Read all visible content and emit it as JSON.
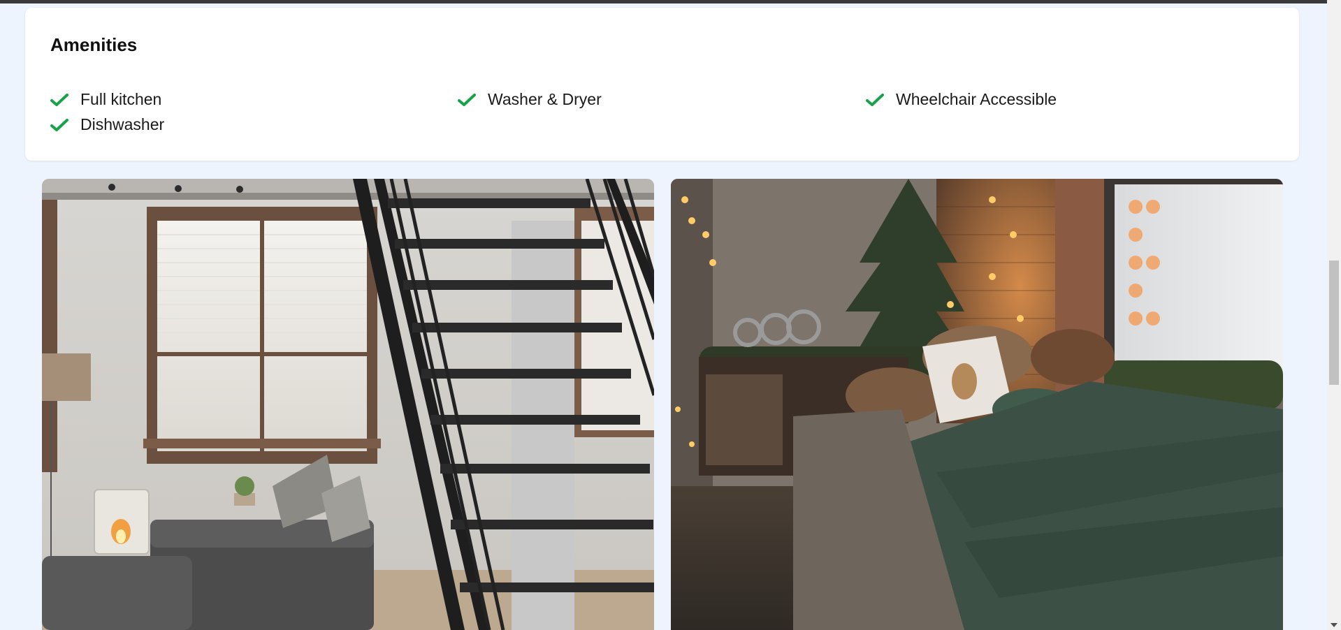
{
  "amenities": {
    "title": "Amenities",
    "items": [
      {
        "label": "Full kitchen",
        "icon": "check-icon"
      },
      {
        "label": "Washer & Dryer",
        "icon": "check-icon"
      },
      {
        "label": "Wheelchair Accessible",
        "icon": "check-icon"
      },
      {
        "label": "Dishwasher",
        "icon": "check-icon"
      }
    ],
    "check_color": "#16a34a"
  },
  "gallery": {
    "photos": [
      {
        "subject": "loft-living-room-with-staircase"
      },
      {
        "subject": "cozy-bedroom-with-string-lights"
      }
    ]
  }
}
